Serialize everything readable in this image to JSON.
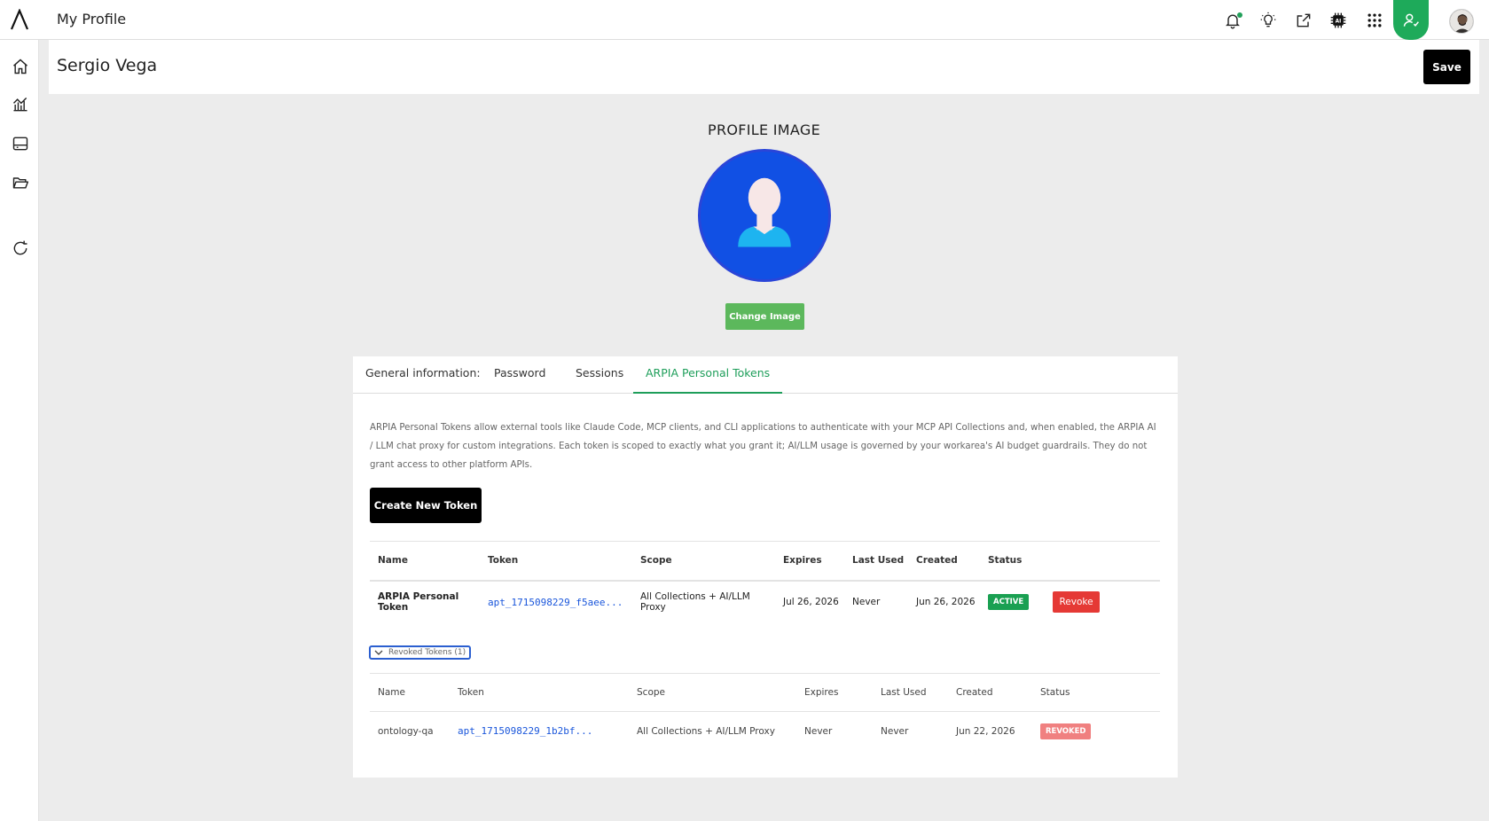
{
  "topbar": {
    "title": "My Profile",
    "icons": [
      "bell-icon",
      "lightbulb-icon",
      "share-icon",
      "ai-chip-icon",
      "apps-grid-icon",
      "user-tab-icon"
    ],
    "accent": "#1eaa5a"
  },
  "sidebar": {
    "icons": [
      "home-icon",
      "analytics-icon",
      "dashboard-icon",
      "folder-icon",
      "refresh-icon"
    ]
  },
  "header": {
    "name": "Sergio Vega",
    "save_label": "Save"
  },
  "profile_image": {
    "title": "PROFILE IMAGE",
    "change_label": "Change Image"
  },
  "tabs": [
    {
      "label": "General information:"
    },
    {
      "label": "Password"
    },
    {
      "label": "Sessions"
    },
    {
      "label": "ARPIA Personal Tokens",
      "active": true
    }
  ],
  "tokens": {
    "description": "ARPIA Personal Tokens allow external tools like Claude Code, MCP clients, and CLI applications to authenticate with your MCP API Collections and, when enabled, the ARPIA AI / LLM chat proxy for custom integrations. Each token is scoped to exactly what you grant it; AI/LLM usage is governed by your workarea's AI budget guardrails. They do not grant access to other platform APIs.",
    "create_label": "Create New Token",
    "columns": [
      "Name",
      "Token",
      "Scope",
      "Expires",
      "Last Used",
      "Created",
      "Status"
    ],
    "active_rows": [
      {
        "name": "ARPIA Personal Token",
        "token": "apt_1715098229_f5aee...",
        "scope": "All Collections + AI/LLM Proxy",
        "expires": "Jul 26, 2026",
        "last_used": "Never",
        "created": "Jun 26, 2026",
        "status": "ACTIVE",
        "action": "Revoke"
      }
    ],
    "revoked_toggle": "Revoked Tokens (1)",
    "revoked_rows": [
      {
        "name": "ontology-qa",
        "token": "apt_1715098229_1b2bf...",
        "scope": "All Collections + AI/LLM Proxy",
        "expires": "Never",
        "last_used": "Never",
        "created": "Jun 22, 2026",
        "status": "REVOKED"
      }
    ]
  }
}
